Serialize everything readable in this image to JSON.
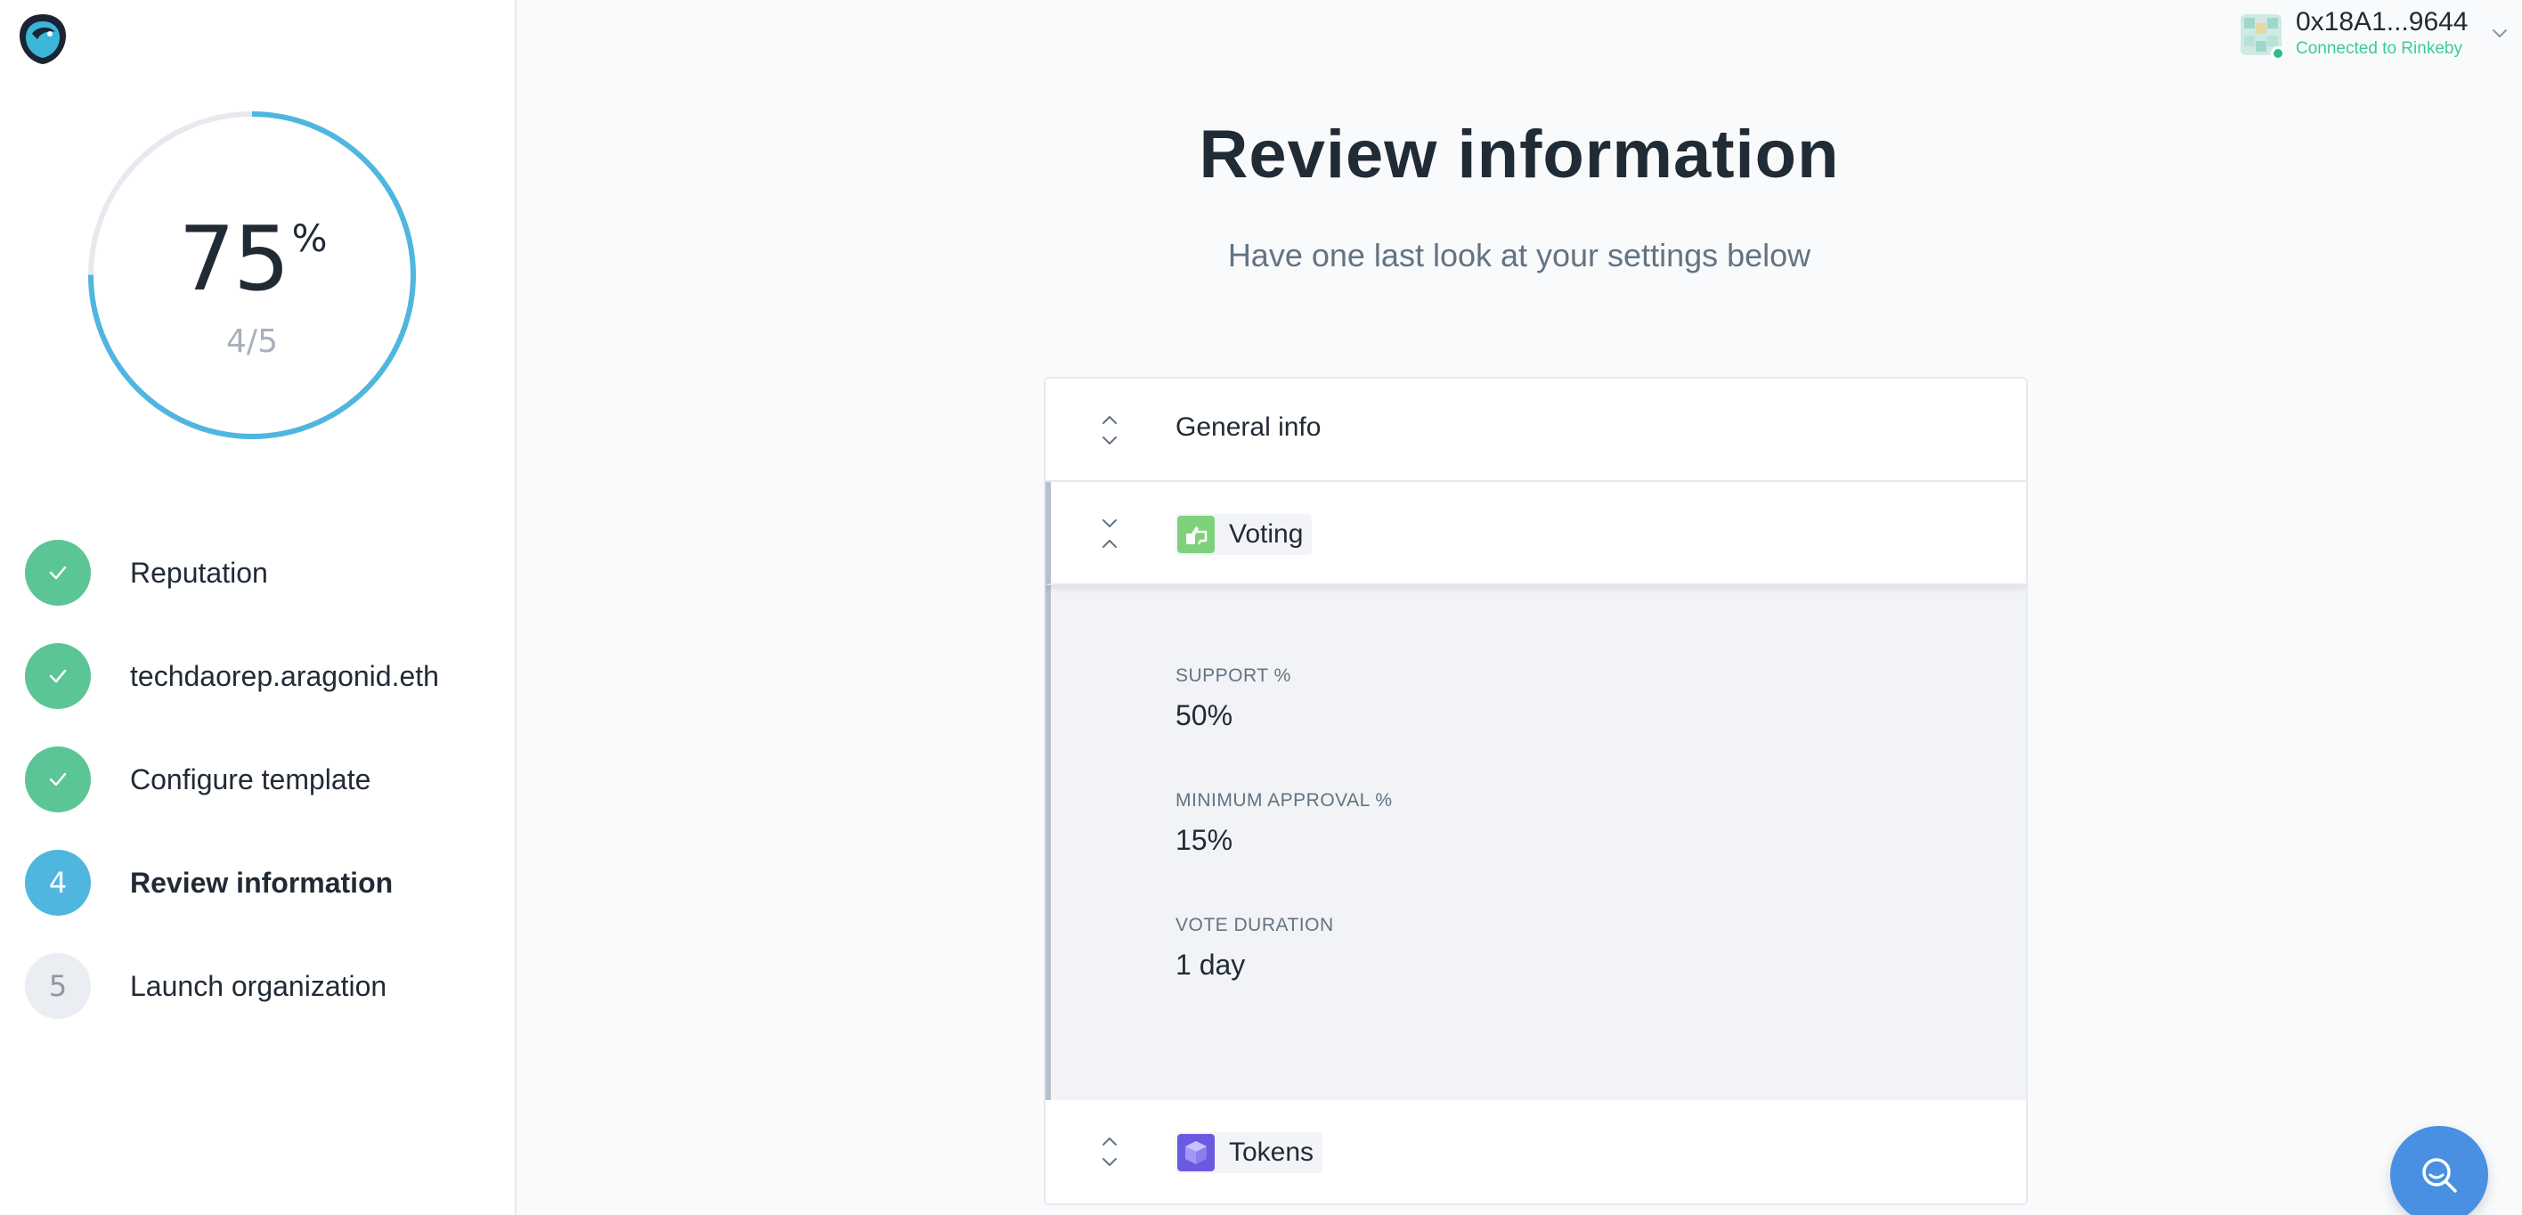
{
  "header": {
    "title": "Review information",
    "subtitle": "Have one last look at your settings below"
  },
  "progress": {
    "percent_value": "75",
    "percent_sign": "%",
    "fraction_complete": 0.75,
    "step_count": "4/5"
  },
  "steps": [
    {
      "label": "Reputation",
      "status": "done"
    },
    {
      "label": "techdaorep.aragonid.eth",
      "status": "done"
    },
    {
      "label": "Configure template",
      "status": "done"
    },
    {
      "label": "Review information",
      "status": "active",
      "number": "4"
    },
    {
      "label": "Launch organization",
      "status": "pending",
      "number": "5"
    }
  ],
  "account": {
    "address": "0x18A1...9644",
    "network": "Connected to Rinkeby"
  },
  "sections": {
    "general": {
      "label": "General info",
      "expanded": false
    },
    "voting": {
      "label": "Voting",
      "expanded": true,
      "icon": "voting-thumbs-icon",
      "fields": [
        {
          "label": "SUPPORT %",
          "value": "50%"
        },
        {
          "label": "MINIMUM APPROVAL %",
          "value": "15%"
        },
        {
          "label": "VOTE DURATION",
          "value": "1 day"
        }
      ]
    },
    "tokens": {
      "label": "Tokens",
      "expanded": false,
      "icon": "tokens-cube-icon"
    }
  },
  "colors": {
    "accent": "#4fb6df",
    "done": "#5bc595",
    "network_green": "#3ec99a",
    "help_button": "#4a90e2"
  },
  "help": {
    "icon": "search-help-icon"
  }
}
